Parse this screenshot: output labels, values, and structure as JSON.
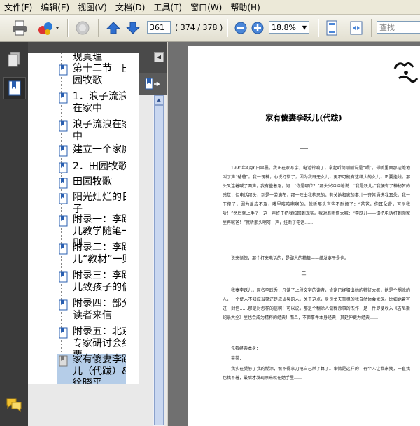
{
  "menu": [
    "文件(F)",
    "编辑(E)",
    "视图(V)",
    "文档(D)",
    "工具(T)",
    "窗口(W)",
    "帮助(H)"
  ],
  "toolbar": {
    "page_current": "361",
    "page_total": "( 374 / 378 )",
    "zoom": "18.8%",
    "search_placeholder": "查找"
  },
  "panel": {
    "title": "书签"
  },
  "bookmarks": [
    {
      "label": "现真理",
      "selected": false
    },
    {
      "label": "第十二节　田园牧歌",
      "selected": false
    },
    {
      "label": "1．浪子流浪在家中",
      "selected": false
    },
    {
      "label": "浪子流浪在家中",
      "selected": false
    },
    {
      "label": "建立一个家庭",
      "selected": false
    },
    {
      "label": "2．田园牧歌",
      "selected": false
    },
    {
      "label": "田园牧歌",
      "selected": false
    },
    {
      "label": "阳光灿烂的日子",
      "selected": false
    },
    {
      "label": "附录一：李跃儿教学随笔一则",
      "selected": false
    },
    {
      "label": "附录二：李跃儿“教材”一则",
      "selected": false
    },
    {
      "label": "附录三：李跃儿致孩子的信",
      "selected": false
    },
    {
      "label": "附录四：部分读者来信",
      "selected": false
    },
    {
      "label": "附录五：北京专家研讨会纪要",
      "selected": false
    },
    {
      "label": "家有傻妻李跃儿（代跋）&徐晓平",
      "selected": true
    }
  ],
  "document": {
    "title": "家有傻妻李跃儿(代跋)",
    "section_mark": "二",
    "paragraphs": [
      "1995年4月6日早晨，我正在家写字，电话铃响了，拿起听筒刚刚说是“喂”，却听里面那边绝地叫了声“爸爸”。我一愣神，心说打错了，因为我既无女儿，更不可能有这样大的女儿。正要挂线，那头又连着喊了两声，我有些着急，问：“你是哪位？”那头兴冲冲地说：“我是跃儿。”我便有了神秘梦的感觉，但电话那头，到是一劳满布，那一阵由我构思的，有关她和家的事儿一齐皆涌进我耳朵。我一下傻了，因为反应不及，嘴里咳咳啊啊的，就听那头有些不耐烦了：“爸爸，你耳朵背，可别我听！”然后就上手了：这一声终于把我拉回到现实。我对着听筒大喊：“李跃儿——请把电话打到你家里再喊爸！”就听那头啊呀一声，挂断了电话……",
      "说来惭愧，那个打来电话的，是鄙人的糟糠——结发妻子是也。",
      "我妻李跃儿，原名李跃秀，凡读了上段文字的读者，肯定已经猜出她的特征大概，她是个糊涂的人，一个使人不知应当笑还是应当哭的人。关于这点，身良丈夫重担的我自然体会尤深。比如她曾写过一封信……那是封怎样的信啊！可以说，那是个糊涂人做糊涂事的杰作！是一件即便收入《吉尼斯纪录大全》里也会成为精粹的经典！而且，不但事件本身经典，其延伸更为经典……",
      "先看经典本身：",
      "英英：",
      "我实在受够了我的糊涂，恨不得拿刀把自己杀了算了。事情是这样的：有个人让我来找，一直找也找不着，最后才发现原来就在她手里……"
    ]
  }
}
